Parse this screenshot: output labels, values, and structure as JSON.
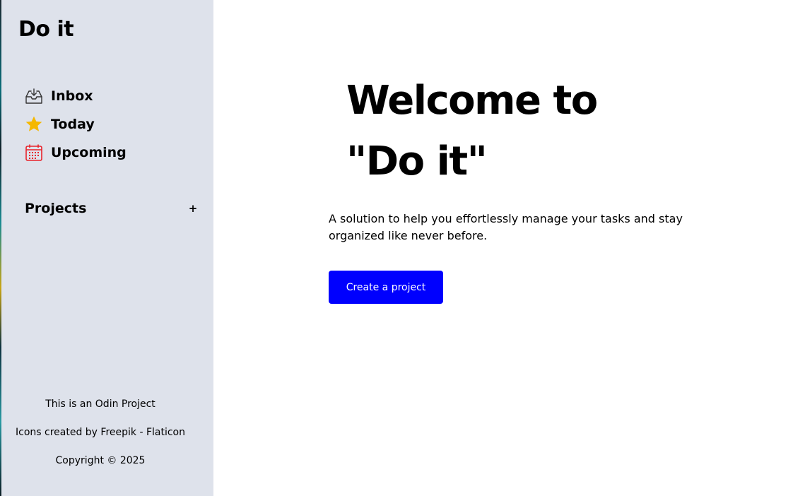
{
  "app": {
    "brand": "Do it"
  },
  "sidebar": {
    "nav": [
      {
        "label": "Inbox",
        "icon": "inbox-icon"
      },
      {
        "label": "Today",
        "icon": "star-icon"
      },
      {
        "label": "Upcoming",
        "icon": "calendar-icon"
      }
    ],
    "projects": {
      "title": "Projects",
      "add_label": "+"
    },
    "footer": {
      "line1": "This is an Odin Project",
      "line2": "Icons created by Freepik - Flaticon",
      "line3": "Copyright © 2025"
    }
  },
  "main": {
    "title_line1": "Welcome to",
    "title_line2": "\"Do it\"",
    "description": "A solution to help you effortlessly manage your tasks and stay organized like never before.",
    "cta_label": "Create a project"
  },
  "colors": {
    "sidebar_bg": "#dee2eb",
    "cta_bg": "#0000fe",
    "star": "#f5b800",
    "calendar": "#e8232b"
  }
}
